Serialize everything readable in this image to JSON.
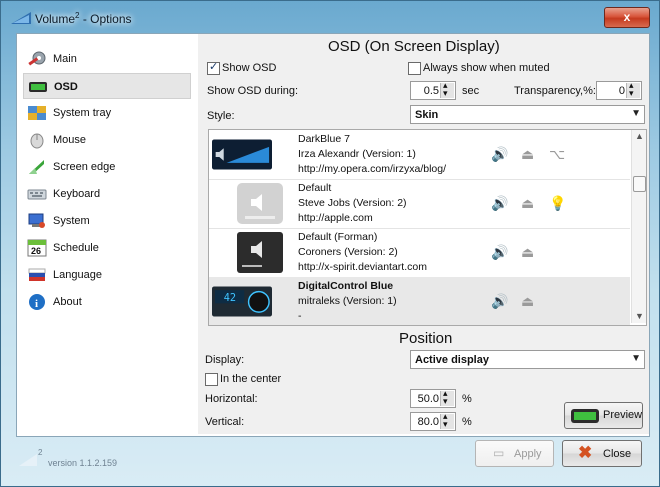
{
  "window": {
    "title": "Volume",
    "title_sup": "2",
    "title_suffix": " - Options",
    "close_glyph": "x"
  },
  "sidebar": {
    "items": [
      {
        "label": "Main",
        "icon": "wrench-gear-icon"
      },
      {
        "label": "OSD",
        "icon": "osd-screen-icon",
        "active": true
      },
      {
        "label": "System tray",
        "icon": "tray-icon"
      },
      {
        "label": "Mouse",
        "icon": "mouse-icon"
      },
      {
        "label": "Screen edge",
        "icon": "screen-edge-icon"
      },
      {
        "label": "Keyboard",
        "icon": "keyboard-icon"
      },
      {
        "label": "System",
        "icon": "system-icon"
      },
      {
        "label": "Schedule",
        "icon": "calendar-icon",
        "icon_text": "26"
      },
      {
        "label": "Language",
        "icon": "flag-icon"
      },
      {
        "label": "About",
        "icon": "info-icon",
        "icon_text": "i"
      }
    ]
  },
  "osd": {
    "title": "OSD (On Screen Display)",
    "show_osd_label": "Show OSD",
    "show_osd_checked": true,
    "always_muted_label": "Always show when muted",
    "always_muted_checked": false,
    "show_during_label": "Show OSD during:",
    "show_during_value": "0.5",
    "show_during_unit": "sec",
    "transparency_label": "Transparency,%:",
    "transparency_value": "0",
    "style_label": "Style:",
    "style_value": "Skin"
  },
  "skins": [
    {
      "name": "DarkBlue 7",
      "author": "Irza Alexandr (Version: 1)",
      "url": "http://my.opera.com/irzyxa/blog/",
      "extra_icon": "usb-icon"
    },
    {
      "name": "Default",
      "author": "Steve Jobs (Version: 2)",
      "url": "http://apple.com",
      "extra_icon": "bulb-icon"
    },
    {
      "name": "Default (Forman)",
      "author": "Coroners (Version: 2)",
      "url": "http://x-spirit.deviantart.com",
      "extra_icon": ""
    },
    {
      "name": "DigitalControl Blue",
      "author": "mitraleks (Version: 1)",
      "url": "-",
      "selected": true,
      "thumb_text": "42",
      "extra_icon": ""
    }
  ],
  "position": {
    "title": "Position",
    "display_label": "Display:",
    "display_value": "Active display",
    "center_label": "In the center",
    "center_checked": false,
    "horizontal_label": "Horizontal:",
    "horizontal_value": "50.0",
    "vertical_label": "Vertical:",
    "vertical_value": "80.0",
    "percent": "%"
  },
  "buttons": {
    "preview": "Preview",
    "apply": "Apply",
    "close": "Close"
  },
  "footer": {
    "logo_sup": "2",
    "version": "version 1.1.2.159"
  },
  "colors": {
    "accent": "#1c7f1c",
    "close_red": "#c53a1f"
  }
}
